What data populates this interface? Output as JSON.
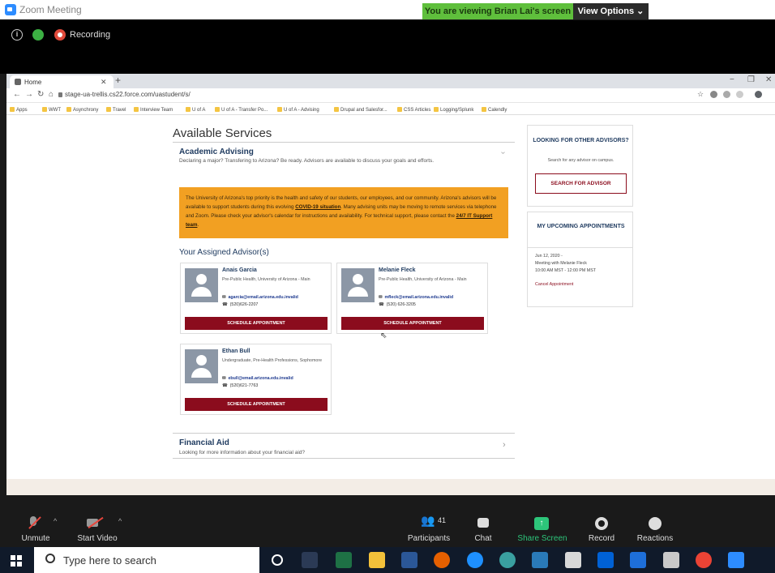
{
  "zoom": {
    "window_title": "Zoom Meeting",
    "viewing_banner": "You are viewing Brian Lai's screen",
    "view_options": "View Options ⌄",
    "recording_label": "Recording",
    "controls": {
      "unmute": "Unmute",
      "start_video": "Start Video",
      "participants": "Participants",
      "participants_count": "41",
      "chat": "Chat",
      "share_screen": "Share Screen",
      "record": "Record",
      "reactions": "Reactions"
    }
  },
  "browser": {
    "tab_title": "Home",
    "url": "stage-ua-trellis.cs22.force.com/uastudent/s/",
    "bookmarks": [
      "Apps",
      "WWT",
      "Asynchrony",
      "Travel",
      "Interview Team",
      "U of A",
      "U of A - Transfer Po...",
      "U of A - Advising",
      "Drupal and Salesfor...",
      "CSS Articles",
      "Logging/Splunk",
      "Calendly"
    ]
  },
  "page": {
    "title": "Available Services",
    "academic_advising": {
      "title": "Academic Advising",
      "subtitle": "Declaring a major? Transfering to Arizona? Be ready. Advisors are available to discuss your goals and efforts."
    },
    "notice": {
      "part1": "The University of Arizona's top priority is the health and safety of our students, our employees, and our community. Arizona's advisors will be available to support students during this evolving ",
      "link1": "COVID-19 situation",
      "part2": ". Many advising units may be moving to remote services via telephone and Zoom. Please check your advisor's calendar for instructions and availability. For technical support, please contact the ",
      "link2": "24/7 IT Support team",
      "part3": "."
    },
    "assigned_title": "Your Assigned Advisor(s)",
    "advisors": [
      {
        "name": "Anais Garcia",
        "program": "Pre-Public Health, University of Arizona - Main",
        "email": "agarcia@email.arizona.edu.invalid",
        "phone": "(520)626-2207",
        "button": "SCHEDULE APPOINTMENT"
      },
      {
        "name": "Melanie Fleck",
        "program": "Pre-Public Health, University of Arizona - Main",
        "email": "mfleck@email.arizona.edu.invalid",
        "phone": "(520) 626-3205",
        "button": "SCHEDULE APPOINTMENT"
      },
      {
        "name": "Ethan Bull",
        "program": "Undergraduate, Pre-Health Professions, Sophomore",
        "email": "ebull@email.arizona.edu.invalid",
        "phone": "(520)621-7763",
        "button": "SCHEDULE APPOINTMENT"
      }
    ],
    "financial_aid": {
      "title": "Financial Aid",
      "subtitle": "Looking for more information about your financial aid?"
    },
    "sidebar": {
      "other_title": "LOOKING FOR OTHER ADVISORS?",
      "other_sub": "Search for any advisor on campus.",
      "search_button": "SEARCH FOR ADVISOR",
      "appt_title": "MY UPCOMING APPOINTMENTS",
      "appt_date": "Jun 12, 2020 -",
      "appt_with": "Meeting with Melanie Fleck",
      "appt_time": "10:00 AM MST - 12:00 PM MST",
      "appt_cancel": "Cancel Appointment"
    }
  },
  "taskbar": {
    "search_placeholder": "Type here to search"
  }
}
